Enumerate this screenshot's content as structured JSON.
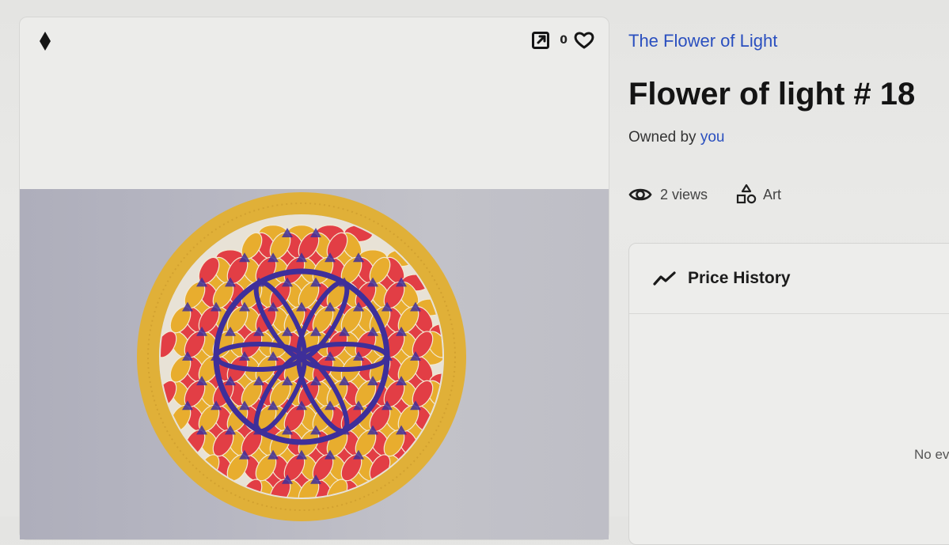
{
  "item_card": {
    "favorite_count": "0",
    "icons": {
      "chain": "ethereum-icon",
      "open": "open-external-icon",
      "favorite": "heart-icon"
    }
  },
  "artwork": {
    "subject": "flower-of-life-mandala",
    "colors": {
      "ring": "#e0b038",
      "petal_gold": "#e8ad2e",
      "petal_red": "#e23e45",
      "petal_blue": "#3e2f9a",
      "background": "#b8b8c2"
    }
  },
  "details": {
    "collection_name": "The Flower of Light",
    "title": "Flower of light # 18",
    "owned_by_prefix": "Owned by",
    "owner": "you",
    "views_label": "2 views",
    "category": "Art",
    "link_color": "#2a4fbf"
  },
  "price_history": {
    "label": "Price History",
    "empty_text": "No ev"
  }
}
